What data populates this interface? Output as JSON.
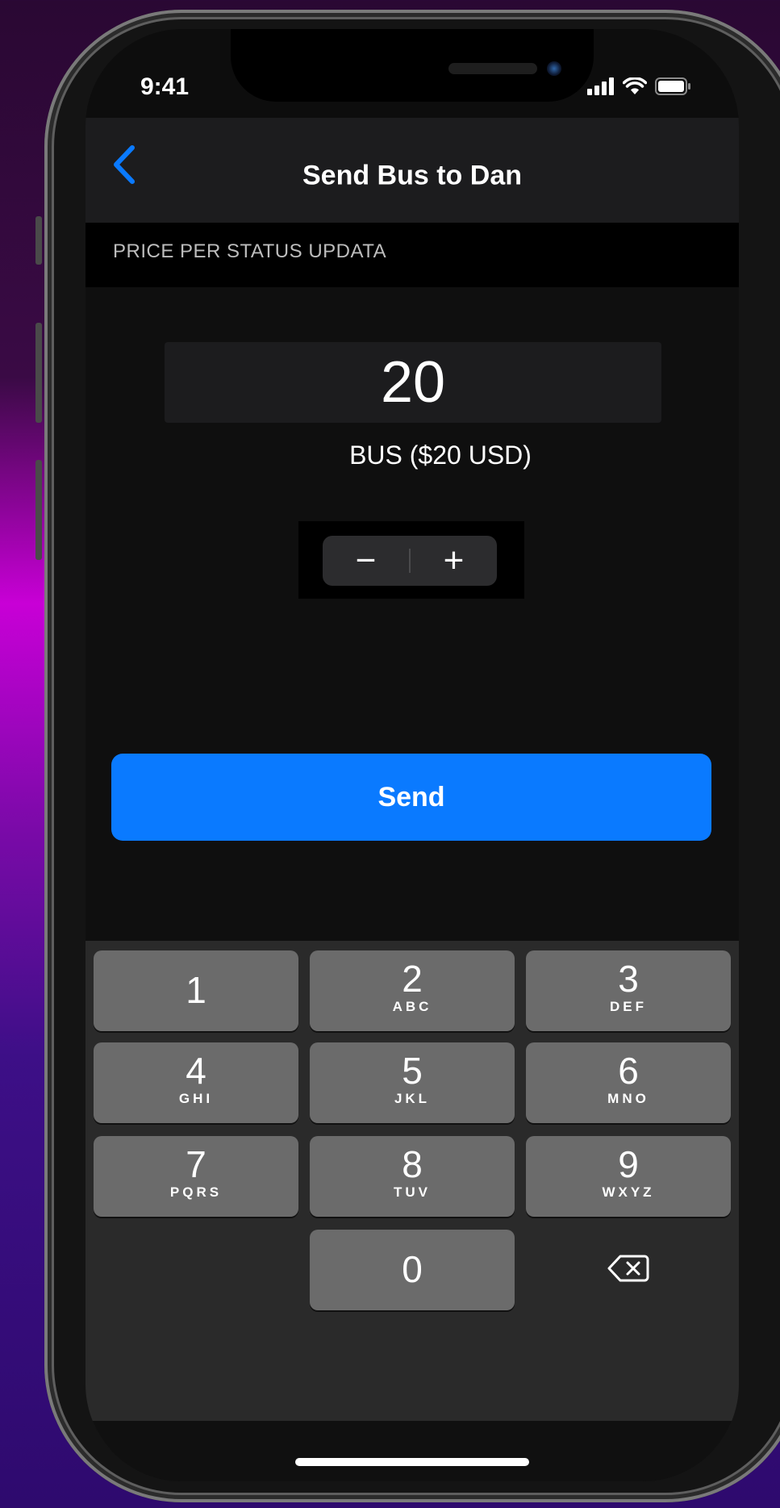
{
  "status_bar": {
    "time": "9:41",
    "icons": [
      "cellular-signal-icon",
      "wifi-icon",
      "battery-icon"
    ]
  },
  "nav": {
    "back_icon": "chevron-left-icon",
    "title": "Send Bus to Dan"
  },
  "section": {
    "header": "PRICE PER STATUS UPDATA"
  },
  "amount": {
    "value": "20",
    "label": "BUS ($20 USD)"
  },
  "stepper": {
    "minus": "−",
    "plus": "+"
  },
  "send_button": {
    "label": "Send"
  },
  "keypad": {
    "keys": [
      {
        "num": "1",
        "letters": ""
      },
      {
        "num": "2",
        "letters": "ABC"
      },
      {
        "num": "3",
        "letters": "DEF"
      },
      {
        "num": "4",
        "letters": "GHI"
      },
      {
        "num": "5",
        "letters": "JKL"
      },
      {
        "num": "6",
        "letters": "MNO"
      },
      {
        "num": "7",
        "letters": "PQRS"
      },
      {
        "num": "8",
        "letters": "TUV"
      },
      {
        "num": "9",
        "letters": "WXYZ"
      },
      {
        "num": "0",
        "letters": ""
      }
    ],
    "delete_icon": "backspace-icon"
  },
  "colors": {
    "accent": "#0a7aff",
    "background": "#0d0d0d",
    "nav_background": "#1c1c1e",
    "key_background": "#6b6b6b"
  }
}
